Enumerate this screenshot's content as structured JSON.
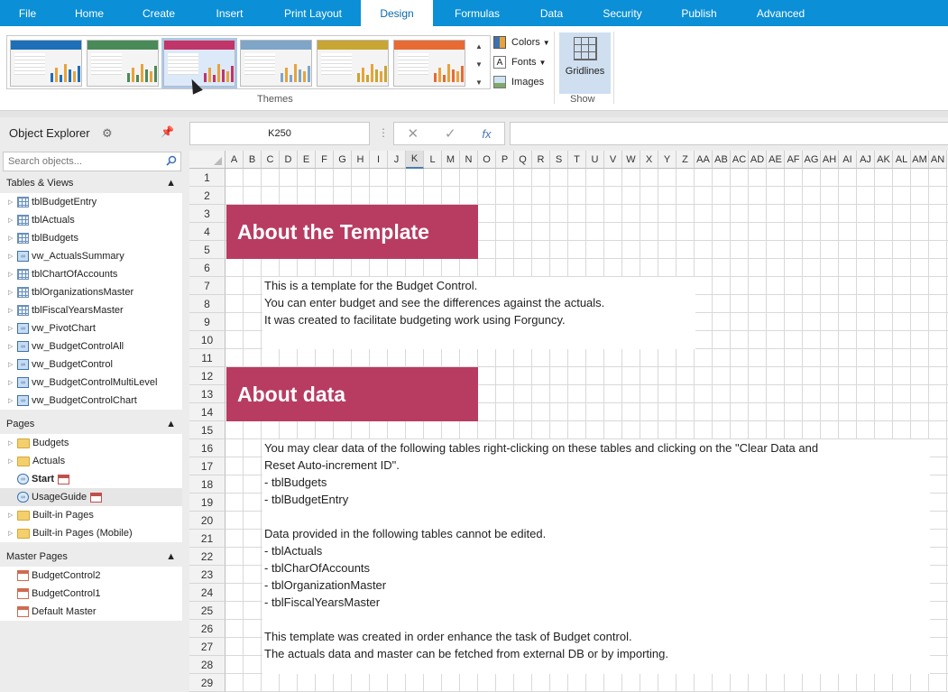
{
  "menu": {
    "tabs": [
      "File",
      "Home",
      "Create",
      "Insert",
      "Print Layout",
      "Design",
      "Formulas",
      "Data",
      "Security",
      "Publish",
      "Advanced"
    ],
    "active": "Design"
  },
  "ribbon": {
    "themes_label": "Themes",
    "colors_label": "Colors",
    "fonts_label": "Fonts",
    "images_label": "Images",
    "gridlines_label": "Gridlines",
    "show_label": "Show",
    "theme_colors": [
      "#1e6fb8",
      "#4a8a58",
      "#c0356a",
      "#7fa5c8",
      "#c8a534",
      "#e86a35"
    ]
  },
  "explorer": {
    "title": "Object Explorer",
    "search_placeholder": "Search objects...",
    "tables_header": "Tables & Views",
    "tables": [
      {
        "label": "tblBudgetEntry",
        "type": "table"
      },
      {
        "label": "tblActuals",
        "type": "table"
      },
      {
        "label": "tblBudgets",
        "type": "table"
      },
      {
        "label": "vw_ActualsSummary",
        "type": "view"
      },
      {
        "label": "tblChartOfAccounts",
        "type": "table"
      },
      {
        "label": "tblOrganizationsMaster",
        "type": "table"
      },
      {
        "label": "tblFiscalYearsMaster",
        "type": "table"
      },
      {
        "label": "vw_PivotChart",
        "type": "view"
      },
      {
        "label": "vw_BudgetControlAll",
        "type": "view"
      },
      {
        "label": "vw_BudgetControl",
        "type": "view"
      },
      {
        "label": "vw_BudgetControlMultiLevel",
        "type": "view"
      },
      {
        "label": "vw_BudgetControlChart",
        "type": "view"
      }
    ],
    "pages_header": "Pages",
    "pages": [
      {
        "label": "Budgets",
        "type": "folder"
      },
      {
        "label": "Actuals",
        "type": "folder"
      },
      {
        "label": "Start",
        "type": "page"
      },
      {
        "label": "UsageGuide",
        "type": "page"
      },
      {
        "label": "Built-in Pages",
        "type": "folder"
      },
      {
        "label": "Built-in Pages (Mobile)",
        "type": "folder"
      }
    ],
    "masters_header": "Master Pages",
    "masters": [
      "BudgetControl2",
      "BudgetControl1",
      "Default Master"
    ]
  },
  "formula": {
    "name_box": "K250",
    "fx_label": "fx"
  },
  "grid": {
    "columns": [
      "A",
      "B",
      "C",
      "D",
      "E",
      "F",
      "G",
      "H",
      "I",
      "J",
      "K",
      "L",
      "M",
      "N",
      "O",
      "P",
      "Q",
      "R",
      "S",
      "T",
      "U",
      "V",
      "W",
      "X",
      "Y",
      "Z",
      "AA",
      "AB",
      "AC",
      "AD",
      "AE",
      "AF",
      "AG",
      "AH",
      "AI",
      "AJ",
      "AK",
      "AL",
      "AM",
      "AN"
    ],
    "selected_column": "K",
    "rows": [
      "1",
      "2",
      "3",
      "4",
      "5",
      "6",
      "7",
      "8",
      "9",
      "10",
      "11",
      "12",
      "13",
      "14",
      "15",
      "16",
      "17",
      "18",
      "19",
      "20",
      "21",
      "22",
      "23",
      "24",
      "25",
      "26",
      "27",
      "28",
      "29"
    ],
    "banner1": "About the Template",
    "banner2": "About data",
    "block1": [
      "This is a template for the Budget Control.",
      "You can enter budget and see the differences against the actuals.",
      "It was created to facilitate budgeting work using Forguncy."
    ],
    "block2": [
      "You may clear data of the following tables right-clicking on these tables and clicking on the \"Clear Data and",
      "Reset Auto-increment ID\".",
      "- tblBudgets",
      "- tblBudgetEntry",
      "",
      "Data provided in the following tables cannot be edited.",
      "- tblActuals",
      "- tblCharOfAccounts",
      "- tblOrganizationMaster",
      "- tblFiscalYearsMaster",
      "",
      "This template was created in order enhance the task of Budget control.",
      "The actuals data and master can be fetched from external DB or by importing."
    ]
  }
}
